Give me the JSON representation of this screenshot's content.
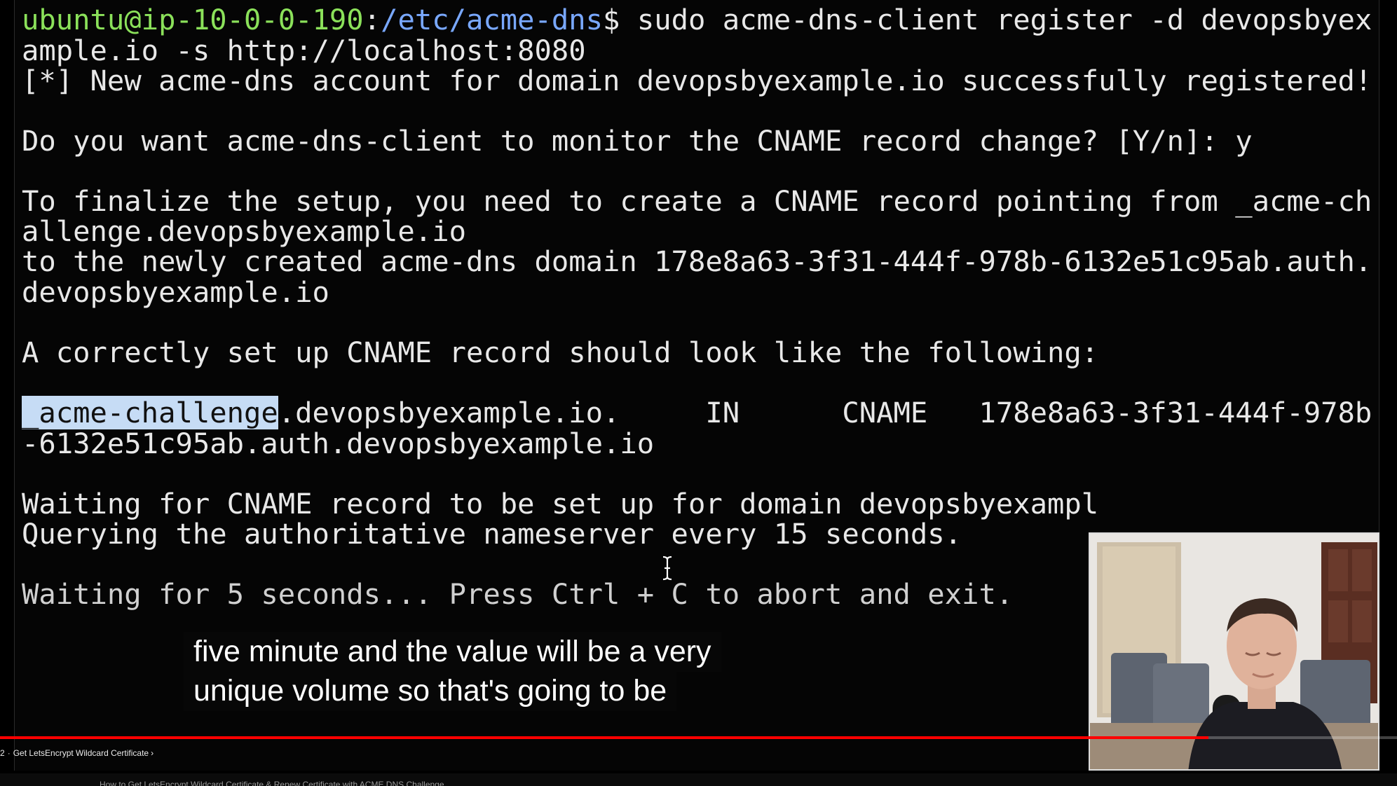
{
  "terminal": {
    "prompt": {
      "user_host": "ubuntu@ip-10-0-0-190",
      "colon": ":",
      "path": "/etc/acme-dns",
      "dollar": "$"
    },
    "command": " sudo acme-dns-client register -d devopsbyex",
    "lines": {
      "l2": "ample.io -s http://localhost:8080",
      "l3_open": "[",
      "l3_star": "*",
      "l3_rest": "] New acme-dns account for domain devopsbyexample.io successfully registered!",
      "l5": "Do you want acme-dns-client to monitor the CNAME record change? [Y/n]: y",
      "l7": "To finalize the setup, you need to create a CNAME record pointing from _acme-ch",
      "l8": "allenge.devopsbyexample.io",
      "l9": "to the newly created acme-dns domain 178e8a63-3f31-444f-978b-6132e51c95ab.auth.",
      "l10": "devopsbyexample.io",
      "l12": "A correctly set up CNAME record should look like the following:",
      "l14_selected": "_acme-challenge",
      "l14_rest": ".devopsbyexample.io.     IN      CNAME   178e8a63-3f31-444f-978b",
      "l15": "-6132e51c95ab.auth.devopsbyexample.io",
      "l17": "Waiting for CNAME record to be set up for domain devopsbyexampl",
      "l18": "Querying the authoritative nameserver every 15 seconds.",
      "l20": "Waiting for 5 seconds... Press Ctrl + C to abort and exit."
    }
  },
  "captions": {
    "line1": "five minute and the value will be a very",
    "line2": "unique volume so that's going to be"
  },
  "player": {
    "progress_fraction": 0.865,
    "chapter_prefix": "2",
    "chapter_title": "Get LetsEncrypt Wildcard Certificate",
    "video_title": "How to Get LetsEncrypt Wildcard Certificate & Renew Certificate with ACME DNS Challenge"
  },
  "colors": {
    "prompt_user": "#8be15a",
    "prompt_path": "#79a8ff",
    "selection": "#c6dcf5",
    "progress": "#ff0000"
  },
  "icons": [
    "text-cursor-icon",
    "chevron-right-icon"
  ]
}
